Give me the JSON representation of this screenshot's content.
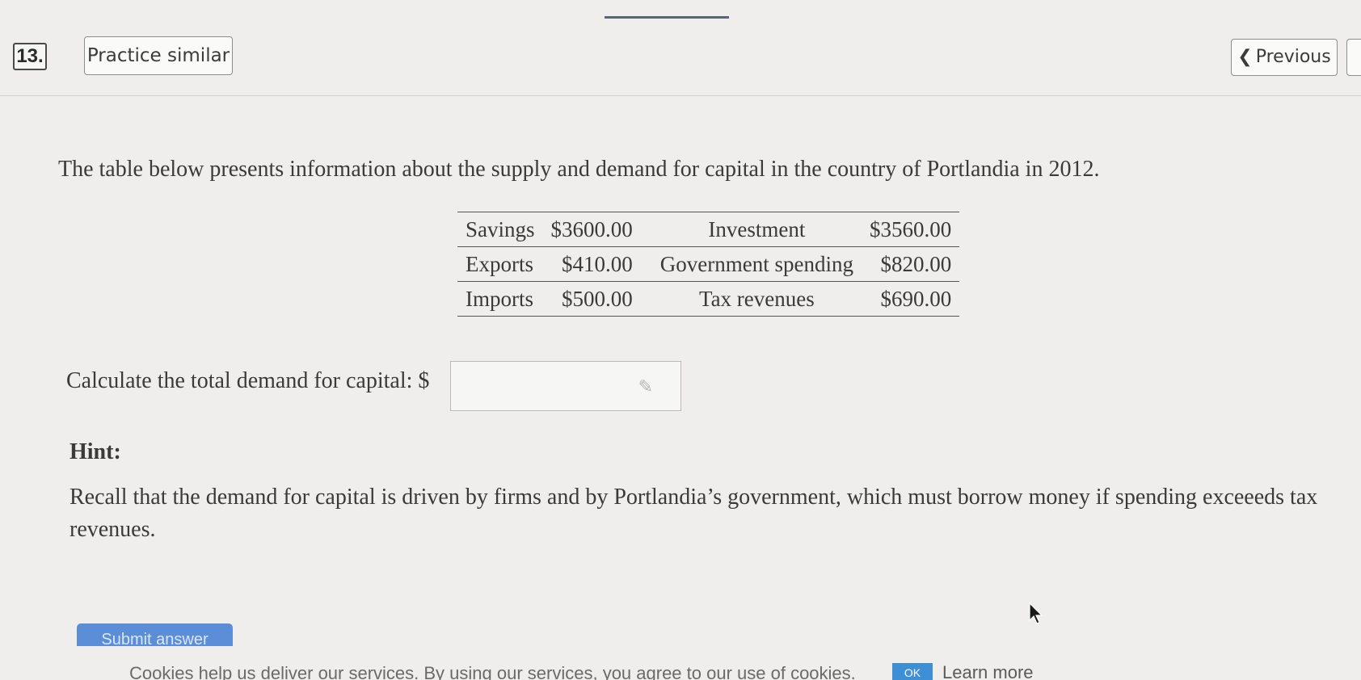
{
  "header": {
    "question_number": "13.",
    "practice_label": "Practice similar",
    "previous_label": "Previous"
  },
  "problem": {
    "intro": "The table below presents information about the supply and demand for capital in the country of Portlandia in 2012.",
    "table": [
      [
        "Savings",
        "$3600.00",
        "Investment",
        "$3560.00"
      ],
      [
        "Exports",
        "$410.00",
        "Government spending",
        "$820.00"
      ],
      [
        "Imports",
        "$500.00",
        "Tax revenues",
        "$690.00"
      ]
    ],
    "question": "Calculate the total demand for capital: $",
    "answer_value": ""
  },
  "hint": {
    "title": "Hint:",
    "text": "Recall that the demand for capital is driven by firms and by Portlandia’s government, which must borrow money if spending exceeeds tax revenues."
  },
  "submit": {
    "label": "Submit answer"
  },
  "cookie": {
    "text": "Cookies help us deliver our services. By using our services, you agree to our use of cookies.",
    "ok_label": "OK",
    "learn_more_label": "Learn more"
  },
  "icons": {
    "previous": "chevron-left-icon",
    "answer": "pencil-icon",
    "cursor": "mouse-cursor-icon"
  }
}
